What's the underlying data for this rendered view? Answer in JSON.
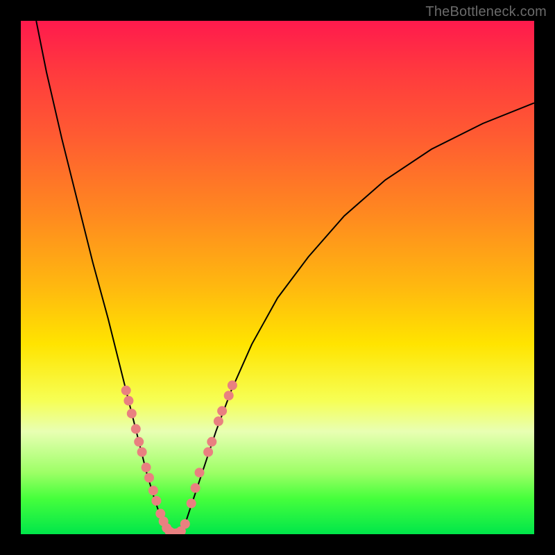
{
  "watermark": "TheBottleneck.com",
  "colors": {
    "frame": "#000000",
    "marker": "#e98080",
    "curve": "#000000",
    "gradient_stops": [
      "#ff1a4d",
      "#ff3a3e",
      "#ff5a32",
      "#ff8a1f",
      "#ffb90f",
      "#ffe400",
      "#f6ff55",
      "#e8ffb3",
      "#9dff66",
      "#46ff3c",
      "#00e64a"
    ]
  },
  "chart_data": {
    "type": "line",
    "title": "",
    "xlabel": "",
    "ylabel": "",
    "xlim": [
      0,
      100
    ],
    "ylim": [
      0,
      100
    ],
    "note": "Axes are unlabeled; x and y are normalized 0–100 from left→right and bottom→top. Two curves form a V meeting near the bottom; y≈0 indicates the optimal (green) region, higher y moves toward red (bottleneck).",
    "series": [
      {
        "name": "left-curve",
        "x": [
          3,
          5,
          8,
          11,
          14,
          17,
          19,
          21,
          23,
          24.5,
          26,
          27,
          28,
          28.5,
          29
        ],
        "y": [
          100,
          90,
          77,
          65,
          53,
          42,
          34,
          26,
          18,
          12,
          7,
          4,
          2,
          1,
          0
        ]
      },
      {
        "name": "right-curve",
        "x": [
          31,
          32,
          33,
          34,
          36,
          38,
          41,
          45,
          50,
          56,
          63,
          71,
          80,
          90,
          100
        ],
        "y": [
          0,
          2,
          5,
          8,
          14,
          20,
          28,
          37,
          46,
          54,
          62,
          69,
          75,
          80,
          84
        ]
      }
    ],
    "markers": {
      "name": "highlighted-points",
      "note": "Salmon dots clustered near the V bottom on both branches.",
      "points": [
        {
          "x": 20.5,
          "y": 28
        },
        {
          "x": 21.0,
          "y": 26
        },
        {
          "x": 21.6,
          "y": 23.5
        },
        {
          "x": 22.4,
          "y": 20.5
        },
        {
          "x": 23.0,
          "y": 18
        },
        {
          "x": 23.6,
          "y": 16
        },
        {
          "x": 24.4,
          "y": 13
        },
        {
          "x": 25.0,
          "y": 11
        },
        {
          "x": 25.8,
          "y": 8.5
        },
        {
          "x": 26.4,
          "y": 6.5
        },
        {
          "x": 27.2,
          "y": 4
        },
        {
          "x": 27.8,
          "y": 2.5
        },
        {
          "x": 28.4,
          "y": 1.2
        },
        {
          "x": 29.0,
          "y": 0.5
        },
        {
          "x": 29.6,
          "y": 0.2
        },
        {
          "x": 30.4,
          "y": 0.2
        },
        {
          "x": 31.2,
          "y": 0.6
        },
        {
          "x": 32.0,
          "y": 2
        },
        {
          "x": 33.2,
          "y": 6
        },
        {
          "x": 34.0,
          "y": 9
        },
        {
          "x": 34.8,
          "y": 12
        },
        {
          "x": 36.5,
          "y": 16
        },
        {
          "x": 37.2,
          "y": 18
        },
        {
          "x": 38.5,
          "y": 22
        },
        {
          "x": 39.2,
          "y": 24
        },
        {
          "x": 40.5,
          "y": 27
        },
        {
          "x": 41.2,
          "y": 29
        }
      ]
    }
  }
}
